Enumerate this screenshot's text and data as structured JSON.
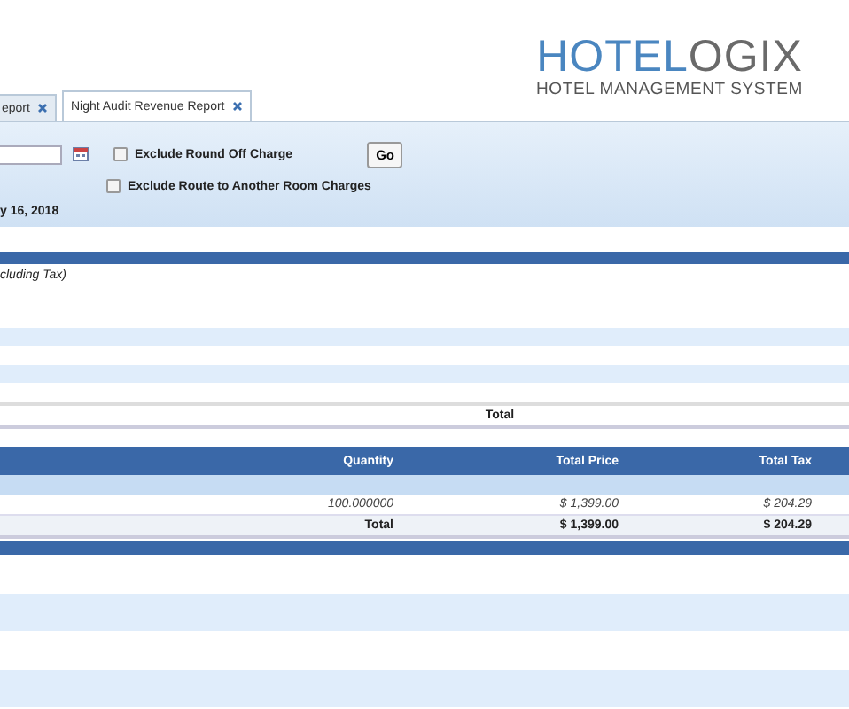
{
  "logo": {
    "brand_first": "HOTEL",
    "brand_second": "OGIX",
    "tagline": "HOTEL MANAGEMENT SYSTEM"
  },
  "tabs": [
    {
      "label": "eport",
      "selected": false
    },
    {
      "label": "Night Audit Revenue Report",
      "selected": true
    }
  ],
  "filters": {
    "checkboxes": [
      {
        "label": "Exclude Round Off Charge",
        "checked": false
      },
      {
        "label": "Exclude Route to Another Room Charges",
        "checked": false
      }
    ],
    "go_button": "Go",
    "report_date": "y 16, 2018"
  },
  "section_note": "cluding Tax)",
  "summary_total_label": "Total",
  "table": {
    "columns": [
      "Quantity",
      "Total Price",
      "Total Tax"
    ],
    "rows": [
      {
        "kind": "data",
        "cells": [
          "100.000000",
          "$ 1,399.00",
          "$ 204.29"
        ]
      },
      {
        "kind": "total",
        "cells": [
          "Total",
          "$ 1,399.00",
          "$ 204.29"
        ]
      }
    ]
  }
}
